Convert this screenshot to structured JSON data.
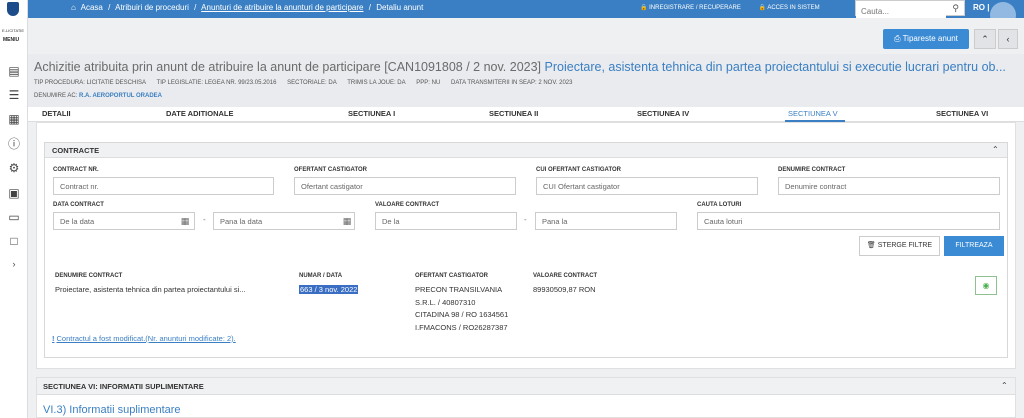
{
  "header": {
    "logo_text": "E-LICITATIE",
    "menu_label": "MENIU",
    "breadcrumb": [
      "Acasa",
      "Atribuiri de proceduri",
      "Anunturi de atribuire la anunturi de participare",
      "Detaliu anunt"
    ],
    "register_link": "INREGISTRARE / RECUPERARE",
    "login_link": "ACCES IN SISTEM",
    "search_placeholder": "Cauta...",
    "lang": "RO | ",
    "print_button": "Tipareste anunt"
  },
  "notice": {
    "title_prefix": "Achizitie atribuita prin anunt de atribuire la anunt de participare [CAN1091808 / 2 nov. 2023]",
    "title_link": "Proiectare, asistenta tehnica din partea proiectantului si executie lucrari pentru ob...",
    "meta": [
      "TIP PROCEDURA: LICITATIE DESCHISA",
      "TIP LEGISLATIE: LEGEA NR. 99/23.05.2016",
      "SECTORIALE: DA",
      "TRIMIS LA JOUE: DA",
      "PPP: NU",
      "DATA TRANSMITERII IN SEAP: 2 NOV. 2023"
    ],
    "ac_label": "DENUMIRE AC:",
    "ac_value": "R.A. AEROPORTUL ORADEA"
  },
  "tabs": [
    "DETALII",
    "DATE ADITIONALE",
    "SECTIUNEA I",
    "SECTIUNEA II",
    "SECTIUNEA IV",
    "SECTIUNEA V",
    "SECTIUNEA VI"
  ],
  "contracte": {
    "title": "CONTRACTE",
    "filters": {
      "contract_nr_label": "CONTRACT NR.",
      "contract_nr_placeholder": "Contract nr.",
      "ofertant_label": "OFERTANT CASTIGATOR",
      "ofertant_placeholder": "Ofertant castigator",
      "cui_label": "CUI OFERTANT CASTIGATOR",
      "cui_placeholder": "CUI Ofertant castigator",
      "denumire_label": "DENUMIRE CONTRACT",
      "denumire_placeholder": "Denumire contract",
      "data_label": "DATA CONTRACT",
      "data_from_placeholder": "De la data",
      "data_to_placeholder": "Pana la data",
      "valoare_label": "VALOARE CONTRACT",
      "valoare_from_placeholder": "De la",
      "valoare_to_placeholder": "Pana la",
      "loturi_label": "CAUTA LOTURI",
      "loturi_placeholder": "Cauta loturi",
      "clear_button": "STERGE FILTRE",
      "filter_button": "FILTREAZA"
    },
    "columns": [
      "DENUMIRE CONTRACT",
      "NUMAR / DATA",
      "OFERTANT CASTIGATOR",
      "VALOARE CONTRACT"
    ],
    "rows": [
      {
        "denumire": "Proiectare, asistenta tehnica din partea proiectantului si...",
        "numar_data": "663 / 3 nov. 2022",
        "ofertant": [
          "PRECON TRANSILVANIA",
          "S.R.L. / 40807310",
          "CITADINA 98 / RO 1634561",
          "I.FMACONS / RO26287387"
        ],
        "valoare": "89930509,87 RON"
      }
    ],
    "modified_note": "Contractul a fost modificat.(Nr. anunturi modificate: 2)."
  },
  "section6": {
    "title": "SECTIUNEA VI: INFORMATII SUPLIMENTARE",
    "subtitle": "VI.3) Informatii suplimentare"
  },
  "colors": {
    "primary": "#3a7fc3",
    "button": "#3a8ad4"
  }
}
